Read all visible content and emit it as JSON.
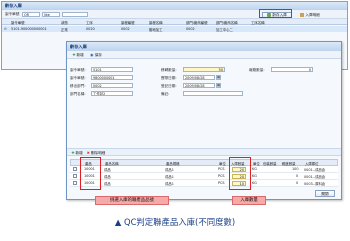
{
  "back_window": {
    "title": "齡存入庫",
    "filter": {
      "label1": "製令單號",
      "label2": "OR",
      "value": "",
      "operator": "like"
    },
    "toolbar": {
      "inbound_label": "齡存入庫",
      "record_label": "入庫明細"
    },
    "grid": {
      "headers": [
        "製令單號",
        "狀態",
        "工序",
        "製程編號",
        "製程名稱",
        "部門/廠商編號",
        "部門/廠商名稱",
        "工序名稱"
      ],
      "row": [
        "5101-900000000001",
        "正常",
        "0020",
        "0002",
        "樹地加工",
        "0002",
        "加工中心二",
        ""
      ]
    }
  },
  "dialog": {
    "title": "齡存入庫",
    "toolbar": {
      "new_label": "新增",
      "save_label": "保存"
    },
    "form": {
      "order_no_label": "製令單號:",
      "order_no": "5101",
      "order_no2_label": "製令單號:",
      "order_no2": "9800000001",
      "dept_label": "移出部門:",
      "dept": "0002",
      "dept_name_label": "部門名稱:",
      "dept_name": "工作站2",
      "qty_label": "移轉數量:",
      "qty": "50",
      "qty_right_label": "報廢數量:",
      "qty_right": "0",
      "date1_label": "實際日期:",
      "date1": "2009/08/28",
      "date2_label": "登記日期:",
      "date2": "2009/08/28",
      "remark_label": "備註:",
      "remark": ""
    },
    "section": {
      "new_label": "新增",
      "delete_label": "刪除明細"
    },
    "grid": {
      "headers": [
        "",
        "產品",
        "產品名稱",
        "產品規格",
        "單位",
        "入庫數量",
        "單位",
        "包裝數量",
        "輕度數量",
        "入庫庫位"
      ],
      "rows": [
        {
          "code": "10001",
          "name": "成品",
          "spec": "成品1",
          "unit": "PCS",
          "qty": "20",
          "unit2": "KG",
          "pack": "",
          "light": "100",
          "loc": "0001--成品倉"
        },
        {
          "code": "10001",
          "name": "成品",
          "spec": "成品1",
          "unit": "PCS",
          "qty": "20",
          "unit2": "KG",
          "pack": "",
          "light": "0",
          "loc": "0001--成品倉"
        },
        {
          "code": "10001",
          "name": "成品",
          "spec": "成品1",
          "unit": "PCS",
          "qty": "10",
          "unit2": "KG",
          "pack": "",
          "light": "0",
          "loc": "0003--原料倉"
        }
      ]
    },
    "close_label": "關閉"
  },
  "annotations": {
    "callout_left": "挑選入庫的聯產品品號",
    "callout_right": "入庫數量"
  },
  "caption": "▲ QC判定聯產品入庫(不同度數)",
  "colors": {
    "title_text": "#1a3f78",
    "highlight_red": "#e02020",
    "callout_bg": "#f5a9a9",
    "caption_text": "#1a3f88"
  }
}
